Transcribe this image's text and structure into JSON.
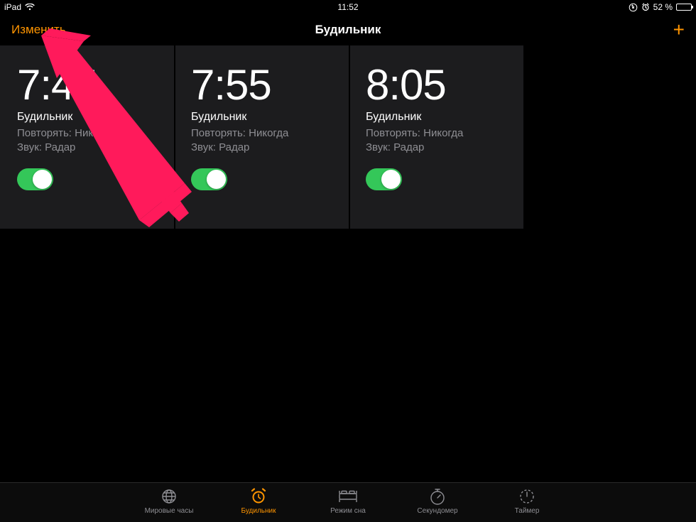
{
  "status": {
    "device": "iPad",
    "time": "11:52",
    "battery_text": "52 %",
    "battery_pct": 52
  },
  "nav": {
    "edit": "Изменить",
    "title": "Будильник"
  },
  "alarms": [
    {
      "time": "7:45",
      "label": "Будильник",
      "repeat": "Повторять: Никогда",
      "sound": "Звук: Радар",
      "on": true
    },
    {
      "time": "7:55",
      "label": "Будильник",
      "repeat": "Повторять: Никогда",
      "sound": "Звук: Радар",
      "on": true
    },
    {
      "time": "8:05",
      "label": "Будильник",
      "repeat": "Повторять: Никогда",
      "sound": "Звук: Радар",
      "on": true
    }
  ],
  "tabs": {
    "world": "Мировые часы",
    "alarm": "Будильник",
    "bedtime": "Режим сна",
    "stopwatch": "Секундомер",
    "timer": "Таймер"
  }
}
